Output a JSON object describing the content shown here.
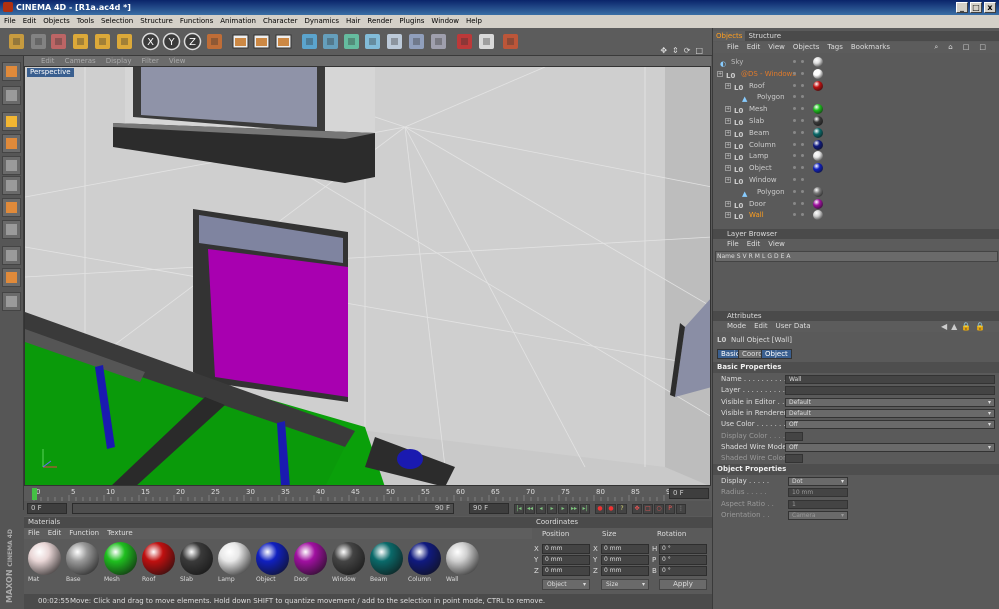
{
  "window": {
    "title": "CINEMA 4D - [R1a.ac4d *]",
    "minimize": "_",
    "maximize": "□",
    "close": "x"
  },
  "menubar": [
    "File",
    "Edit",
    "Objects",
    "Tools",
    "Selection",
    "Structure",
    "Functions",
    "Animation",
    "Character",
    "Dynamics",
    "Hair",
    "Render",
    "Plugins",
    "Window",
    "Help"
  ],
  "toolbar_icons": [
    "undo-icon",
    "redo-icon",
    "live-select-icon",
    "move-icon",
    "scale-icon",
    "rotate-icon",
    "x-axis-icon",
    "y-axis-icon",
    "z-axis-icon",
    "world-coords-icon",
    "render-view-icon",
    "render-picture-viewer-icon",
    "render-settings-icon",
    "cube-icon",
    "nurbs-icon",
    "array-icon",
    "deformer-icon",
    "scene-icon",
    "environment-icon",
    "light-icon",
    "camera-icon",
    "tag-icon",
    "floor-icon"
  ],
  "viewport": {
    "menu": [
      "Edit",
      "Cameras",
      "Display",
      "Filter",
      "View"
    ],
    "label": "Perspective",
    "nav_icons": [
      "move-view-icon",
      "zoom-view-icon",
      "rotate-view-icon",
      "maximize-view-icon"
    ]
  },
  "timeline": {
    "ticks": [
      "0",
      "5",
      "10",
      "15",
      "20",
      "25",
      "30",
      "35",
      "40",
      "45",
      "50",
      "55",
      "60",
      "65",
      "70",
      "75",
      "80",
      "85",
      "90"
    ],
    "current_frame": "0 F",
    "start_field": "0 F",
    "end_field": "90 F",
    "end_field2": "90 F"
  },
  "materials": {
    "title": "Materials",
    "menu": [
      "File",
      "Edit",
      "Function",
      "Texture"
    ],
    "items": [
      {
        "name": "Mat",
        "color": "#e9d6d6"
      },
      {
        "name": "Base",
        "color": "#9a9a9a"
      },
      {
        "name": "Mesh",
        "color": "#1fbf1f"
      },
      {
        "name": "Roof",
        "color": "#c01010"
      },
      {
        "name": "Slab",
        "color": "#3a3a3a"
      },
      {
        "name": "Lamp",
        "color": "#e8e8e8"
      },
      {
        "name": "Object",
        "color": "#1020c0"
      },
      {
        "name": "Door",
        "color": "#a010a0"
      },
      {
        "name": "Window",
        "color": "#444444"
      },
      {
        "name": "Beam",
        "color": "#0a6a6a"
      },
      {
        "name": "Column",
        "color": "#101a80"
      },
      {
        "name": "Wall",
        "color": "#cfcfcf"
      }
    ]
  },
  "coordinates": {
    "title": "Coordinates",
    "headers": [
      "Position",
      "Size",
      "Rotation"
    ],
    "rows": [
      {
        "axis": "X",
        "pos": "0 mm",
        "size_axis": "X",
        "size": "0 mm",
        "rot_axis": "H",
        "rot": "0 °"
      },
      {
        "axis": "Y",
        "pos": "0 mm",
        "size_axis": "Y",
        "size": "0 mm",
        "rot_axis": "P",
        "rot": "0 °"
      },
      {
        "axis": "Z",
        "pos": "0 mm",
        "size_axis": "Z",
        "size": "0 mm",
        "rot_axis": "B",
        "rot": "0 °"
      }
    ],
    "mode_select": "Object",
    "size_select": "Size",
    "apply": "Apply"
  },
  "status": {
    "time": "00:02:55",
    "message": "Move: Click and drag to move elements. Hold down SHIFT to quantize movement / add to the selection in point mode, CTRL to remove."
  },
  "maxon": {
    "line1": "MAXON",
    "line2": "CINEMA 4D"
  },
  "objects_panel": {
    "tabs": [
      "Objects",
      "Structure"
    ],
    "menu": [
      "File",
      "Edit",
      "View",
      "Objects",
      "Tags",
      "Bookmarks"
    ],
    "items": [
      {
        "name": "Sky",
        "indent": 0,
        "kind": "sky",
        "tag": "#dddddd",
        "color": "#bbbbbb"
      },
      {
        "name": "@DS - Windows",
        "indent": 0,
        "kind": "null",
        "tag": "#ffffff",
        "color": "#e07a2a"
      },
      {
        "name": "Roof",
        "indent": 1,
        "kind": "null",
        "tag": "#c01010",
        "color": "#cccccc"
      },
      {
        "name": "Polygon",
        "indent": 2,
        "kind": "poly",
        "tag": "",
        "color": "#cccccc"
      },
      {
        "name": "Mesh",
        "indent": 1,
        "kind": "null",
        "tag": "#1fbf1f",
        "color": "#cccccc"
      },
      {
        "name": "Slab",
        "indent": 1,
        "kind": "null",
        "tag": "#3a3a3a",
        "color": "#cccccc"
      },
      {
        "name": "Beam",
        "indent": 1,
        "kind": "null",
        "tag": "#0a6a6a",
        "color": "#cccccc"
      },
      {
        "name": "Column",
        "indent": 1,
        "kind": "null",
        "tag": "#101a80",
        "color": "#cccccc"
      },
      {
        "name": "Lamp",
        "indent": 1,
        "kind": "null",
        "tag": "#e8e8e8",
        "color": "#cccccc"
      },
      {
        "name": "Object",
        "indent": 1,
        "kind": "null",
        "tag": "#1020c0",
        "color": "#cccccc"
      },
      {
        "name": "Window",
        "indent": 1,
        "kind": "null",
        "tag": "",
        "color": "#cccccc"
      },
      {
        "name": "Polygon",
        "indent": 2,
        "kind": "poly",
        "tag": "#777777",
        "color": "#cccccc"
      },
      {
        "name": "Door",
        "indent": 1,
        "kind": "null",
        "tag": "#a010a0",
        "color": "#cccccc"
      },
      {
        "name": "Wall",
        "indent": 1,
        "kind": "null",
        "tag": "#cfcfcf",
        "color": "#ff9f20"
      }
    ]
  },
  "layer_panel": {
    "title": "Layer Browser",
    "menu": [
      "File",
      "Edit",
      "View"
    ],
    "columns": [
      "Name",
      "S",
      "V",
      "R",
      "M",
      "L",
      "G",
      "D",
      "E",
      "A"
    ]
  },
  "attributes_panel": {
    "title": "Attributes",
    "menu": [
      "Mode",
      "Edit",
      "User Data"
    ],
    "object_label": "Null Object [Wall]",
    "tabs": [
      "Basic",
      "Coord",
      "Object"
    ],
    "basic_title": "Basic Properties",
    "basic_rows": [
      {
        "label": "Name . . . . . . . . . . . .",
        "value": "Wall",
        "type": "text",
        "dim": false
      },
      {
        "label": "Layer . . . . . . . . . . . .",
        "value": "",
        "type": "text",
        "dim": false
      },
      {
        "label": "Visible in Editor . . .",
        "value": "Default",
        "type": "dd",
        "dim": false
      },
      {
        "label": "Visible in Renderer . .",
        "value": "Default",
        "type": "dd",
        "dim": false
      },
      {
        "label": "Use Color . . . . . . . .",
        "value": "Off",
        "type": "dd",
        "dim": false
      },
      {
        "label": "Display Color . . . . .",
        "value": "",
        "type": "swatch",
        "dim": true
      },
      {
        "label": "Shaded Wire Mode . .",
        "value": "Off",
        "type": "dd",
        "dim": false
      },
      {
        "label": "Shaded Wire Color . .",
        "value": "",
        "type": "swatch",
        "dim": true
      }
    ],
    "object_title": "Object Properties",
    "object_rows": [
      {
        "label": "Display . . . . .",
        "value": "Dot",
        "type": "dd",
        "dim": false
      },
      {
        "label": "Radius . . . . .",
        "value": "10 mm",
        "type": "text",
        "dim": true
      },
      {
        "label": "Aspect Ratio . .",
        "value": "1",
        "type": "text",
        "dim": true
      },
      {
        "label": "Orientation . .",
        "value": "Camera",
        "type": "dd",
        "dim": true
      }
    ]
  }
}
